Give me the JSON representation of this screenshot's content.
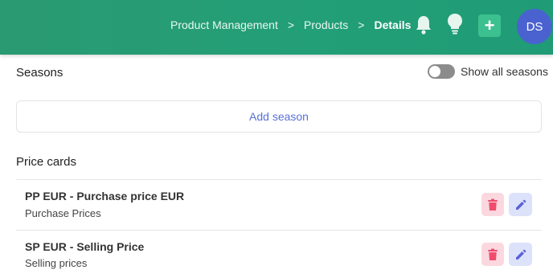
{
  "header": {
    "breadcrumb": [
      "Product Management",
      "Products",
      "Details"
    ],
    "separator": ">",
    "add_symbol": "+",
    "avatar_initials": "DS"
  },
  "seasons": {
    "title": "Seasons",
    "toggle_label": "Show all seasons",
    "toggle_on": false,
    "add_label": "Add season"
  },
  "price_cards": {
    "title": "Price cards",
    "items": [
      {
        "title": "PP EUR - Purchase price EUR",
        "subtitle": "Purchase Prices"
      },
      {
        "title": "SP EUR - Selling Price",
        "subtitle": "Selling prices"
      }
    ]
  },
  "colors": {
    "header_green": "#239f77",
    "accent_blue": "#5871d8",
    "delete_bg": "#fbd8df",
    "edit_bg": "#dde2fb"
  },
  "icons": [
    "bell-icon",
    "lightbulb-icon",
    "plus-icon",
    "trash-icon",
    "pencil-icon",
    "chevron-right-icon"
  ]
}
